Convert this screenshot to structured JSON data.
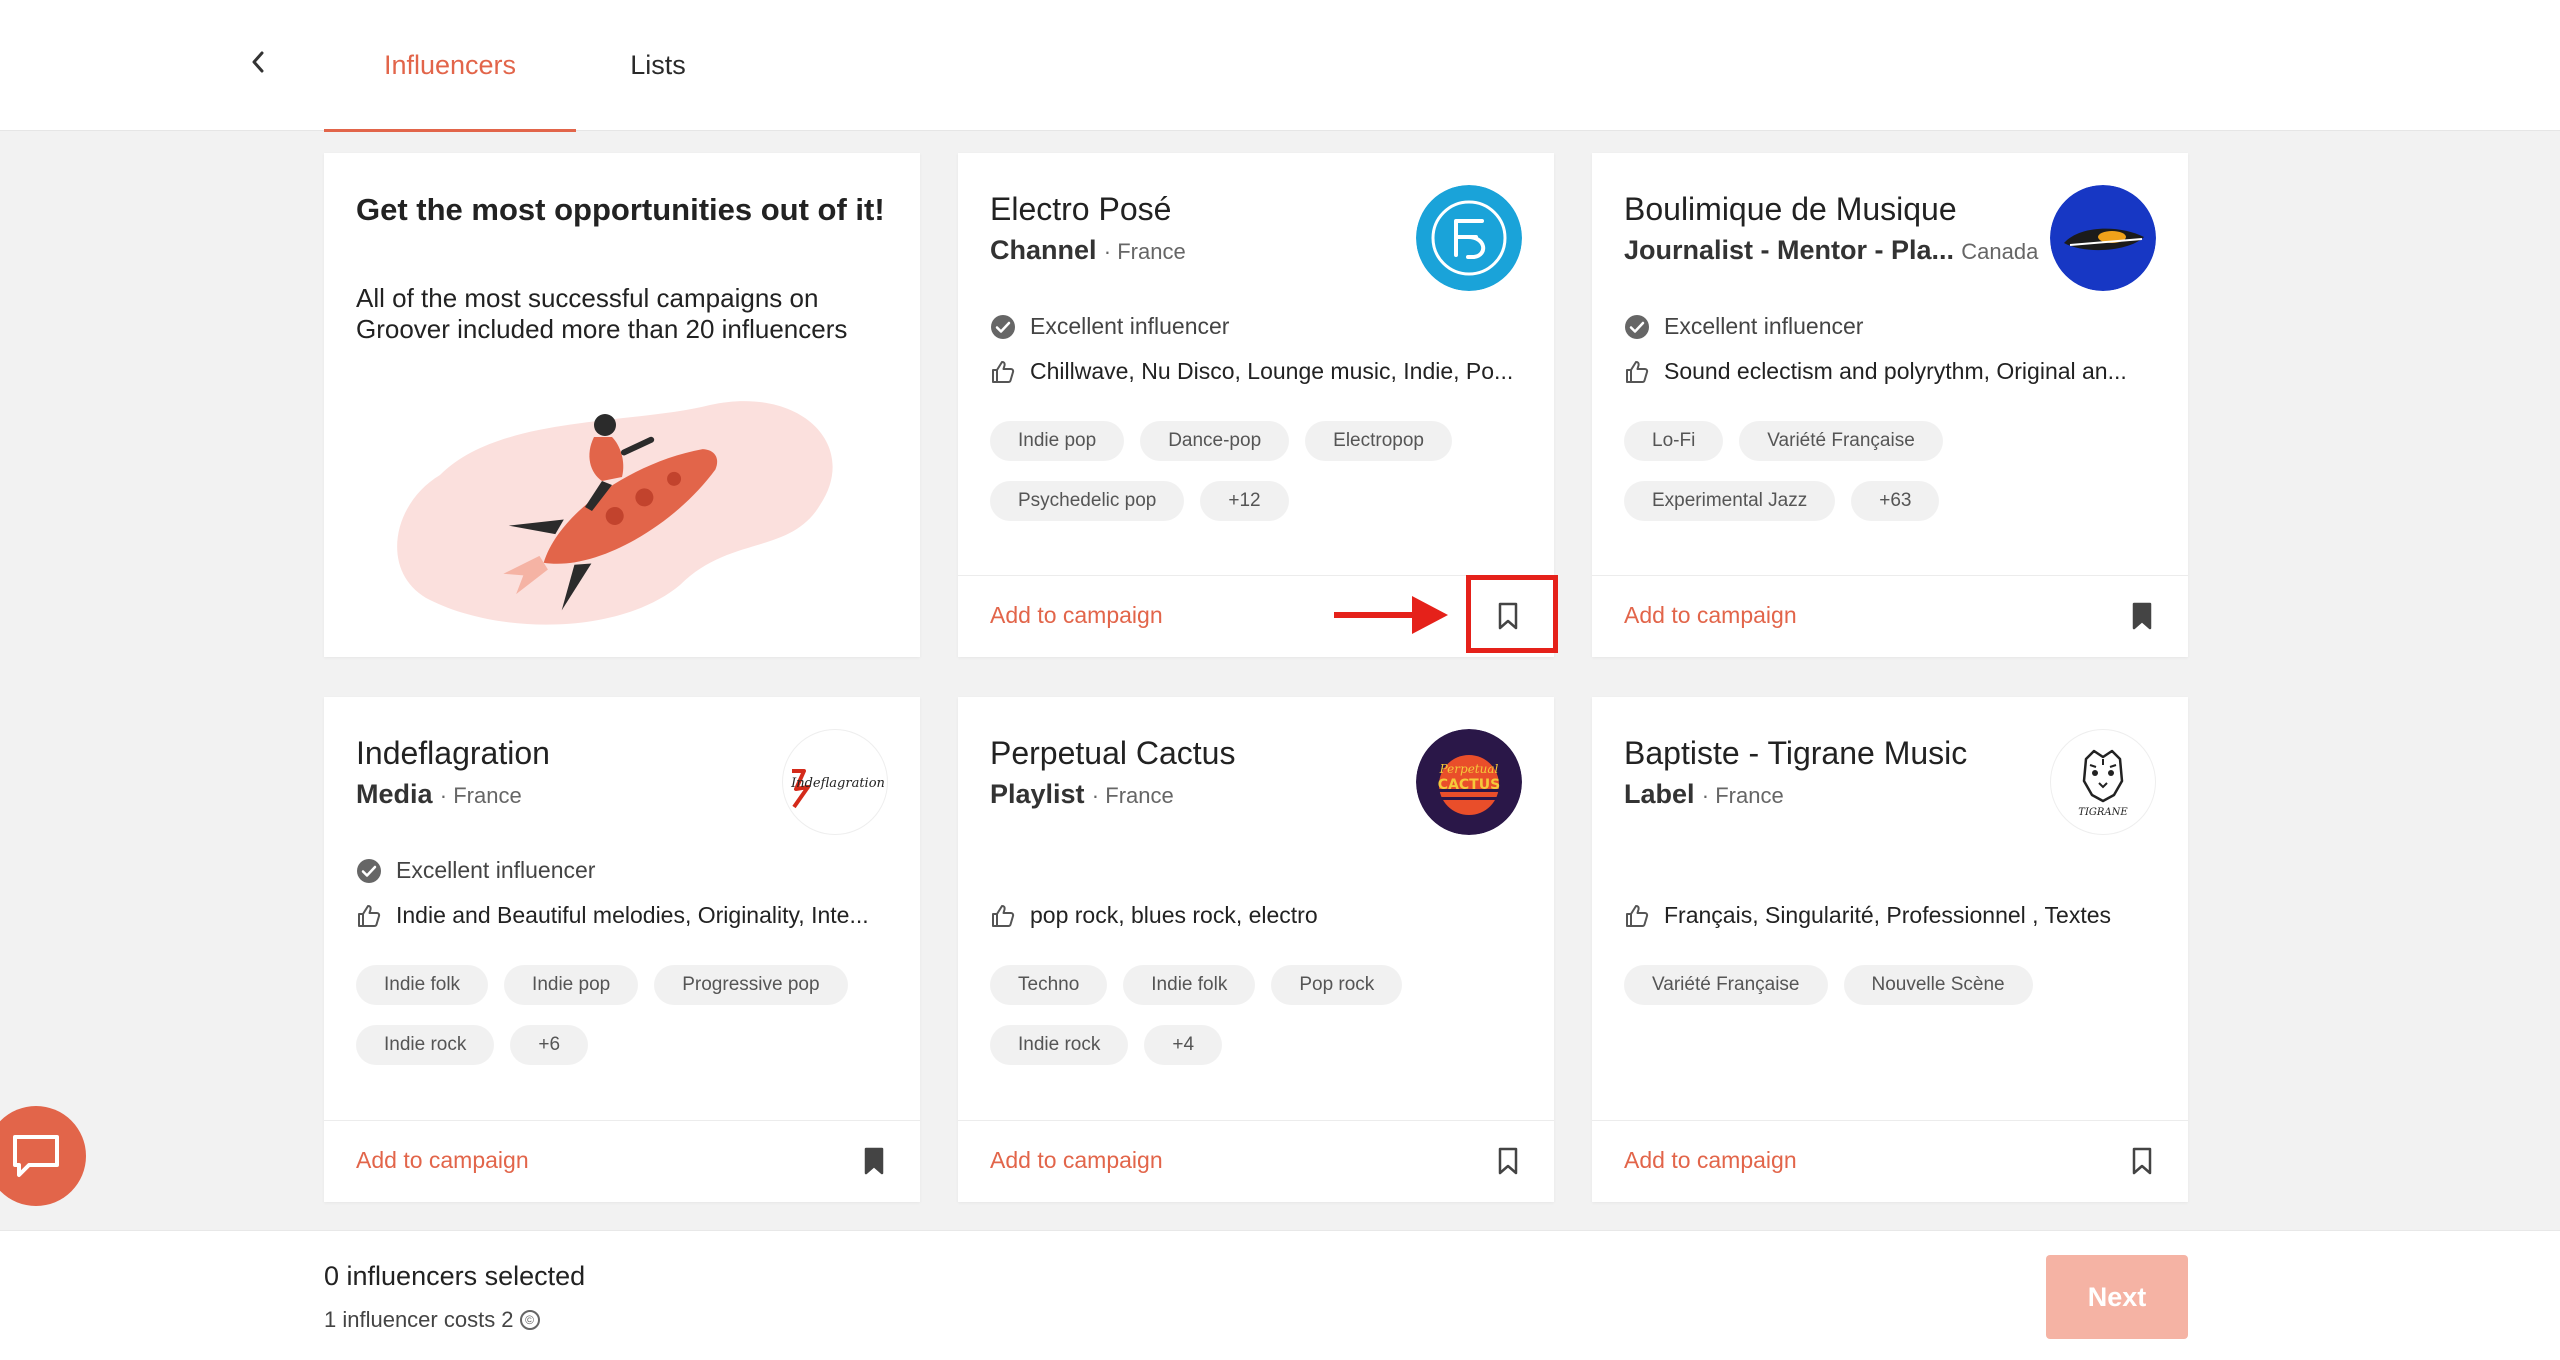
{
  "header": {
    "tabs": [
      {
        "label": "Influencers",
        "active": true
      },
      {
        "label": "Lists",
        "active": false
      }
    ]
  },
  "promo": {
    "title": "Get the most opportunities out of it!",
    "text": "All of the most successful campaigns on Groover included more than 20 influencers"
  },
  "cards": [
    {
      "name": "Electro Posé",
      "type": "Channel",
      "country": "France",
      "status": "Excellent influencer",
      "genres": "Chillwave, Nu Disco, Lounge music, Indie, Po...",
      "tags": [
        "Indie pop",
        "Dance-pop",
        "Electropop",
        "Psychedelic pop",
        "+12"
      ],
      "add_label": "Add to campaign",
      "bookmarked": false
    },
    {
      "name": "Boulimique de Musique",
      "type": "Journalist - Mentor - Pla...",
      "country": "Canada",
      "status": "Excellent influencer",
      "genres": "Sound eclectism and polyrythm, Original an...",
      "tags": [
        "Lo-Fi",
        "Variété Française",
        "Experimental Jazz",
        "+63"
      ],
      "add_label": "Add to campaign",
      "bookmarked": true
    },
    {
      "name": "Indeflagration",
      "type": "Media",
      "country": "France",
      "status": "Excellent influencer",
      "genres": "Indie and Beautiful melodies, Originality, Inte...",
      "tags": [
        "Indie folk",
        "Indie pop",
        "Progressive pop",
        "Indie rock",
        "+6"
      ],
      "add_label": "Add to campaign",
      "bookmarked": true
    },
    {
      "name": "Perpetual Cactus",
      "type": "Playlist",
      "country": "France",
      "genres": "pop rock, blues rock, electro",
      "tags": [
        "Techno",
        "Indie folk",
        "Pop rock",
        "Indie rock",
        "+4"
      ],
      "add_label": "Add to campaign",
      "bookmarked": false
    },
    {
      "name": "Baptiste - Tigrane Music",
      "type": "Label",
      "country": "France",
      "genres": "Français, Singularité, Professionnel , Textes",
      "tags": [
        "Variété Française",
        "Nouvelle Scène"
      ],
      "add_label": "Add to campaign",
      "bookmarked": false
    }
  ],
  "avatars": {
    "indeflagration_logo_text": "Indeflagration",
    "cactus_logo_line1": "Perpetual",
    "cactus_logo_line2": "CACTUS",
    "tigrane_logo_text": "TIGRANE"
  },
  "footer": {
    "selected": "0 influencers selected",
    "cost": "1 influencer costs 2",
    "next_label": "Next"
  },
  "colors": {
    "accent": "#e2654a",
    "highlight": "#e5211a",
    "next_disabled": "#f5b3a4"
  }
}
